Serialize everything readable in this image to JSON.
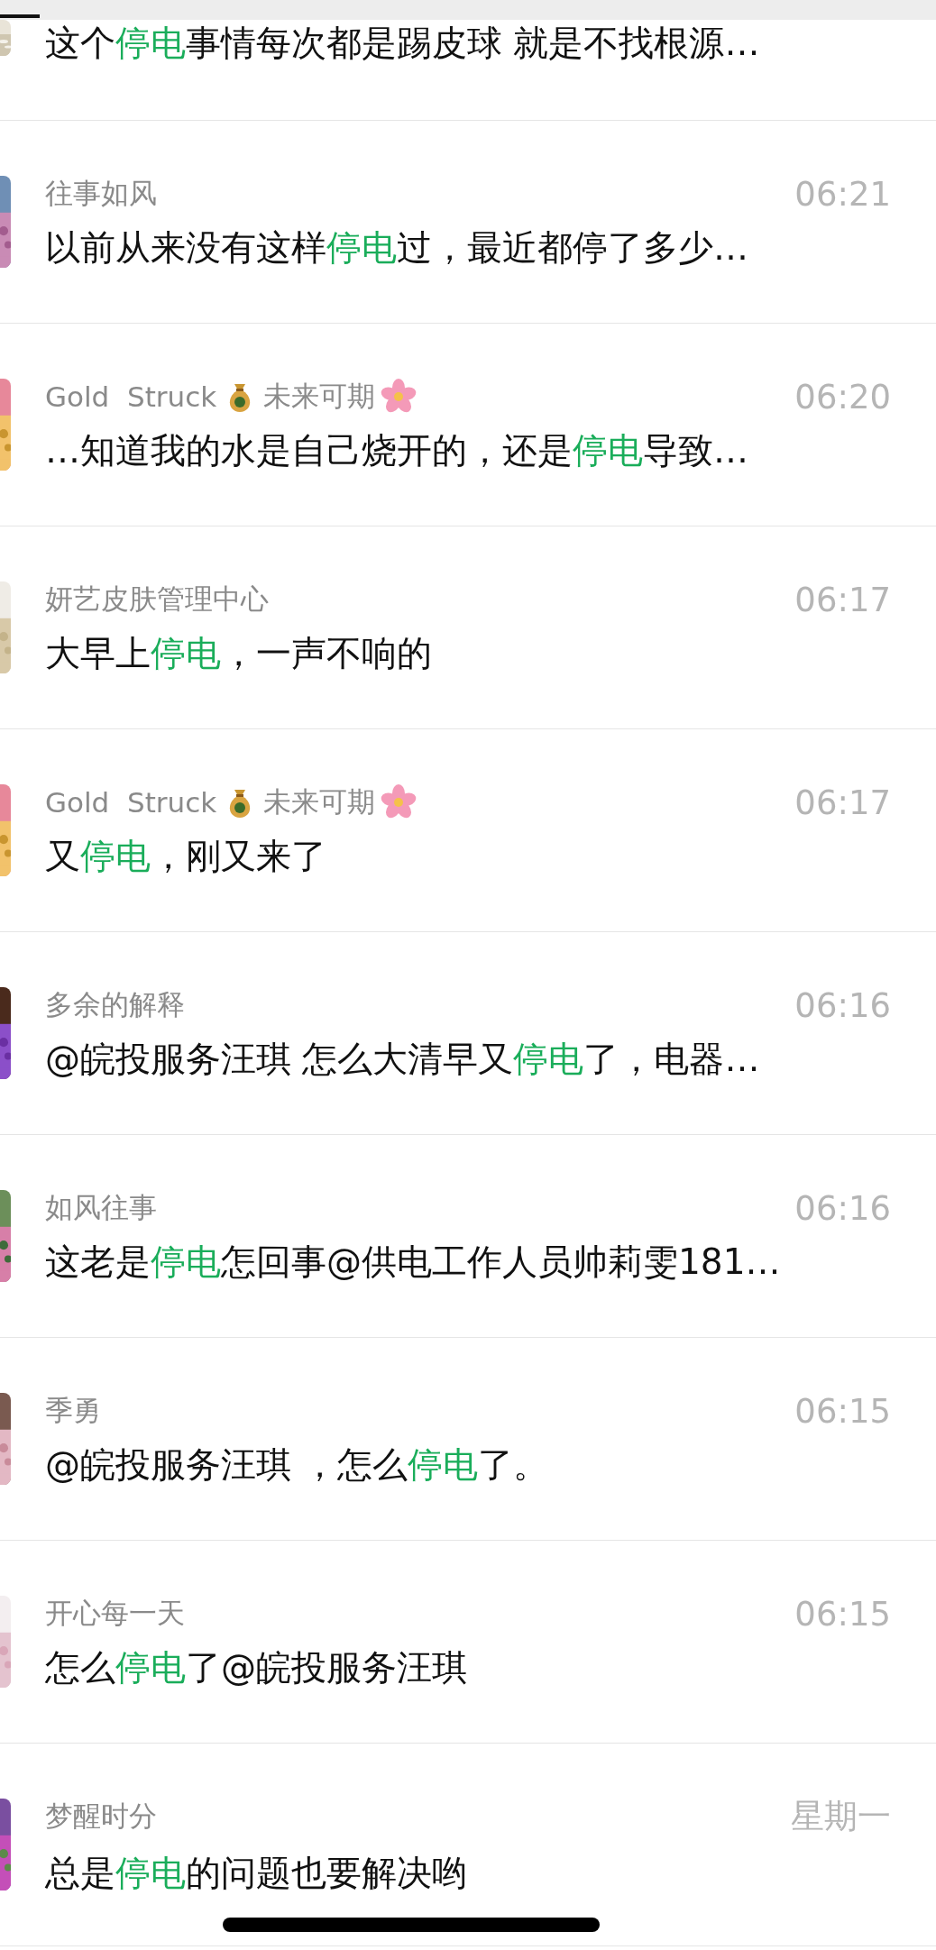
{
  "results": [
    {
      "partial": true,
      "message": [
        {
          "text": "这个",
          "highlight": false
        },
        {
          "text": "停电",
          "highlight": true
        },
        {
          "text": "事情每次都是踢皮球 就是不找根源…",
          "highlight": false
        }
      ]
    },
    {
      "name": [
        {
          "kind": "text",
          "text": "往事如风"
        }
      ],
      "time": "06:21",
      "message": [
        {
          "text": "以前从来没有这样",
          "highlight": false
        },
        {
          "text": "停电",
          "highlight": true
        },
        {
          "text": "过，最近都停了多少…",
          "highlight": false
        }
      ]
    },
    {
      "name": [
        {
          "kind": "text",
          "text": "Gold  Struck"
        },
        {
          "kind": "moneybag"
        },
        {
          "kind": "text",
          "text": "未来可期"
        },
        {
          "kind": "blossom"
        }
      ],
      "time": "06:20",
      "message": [
        {
          "text": "…知道我的水是自己烧开的，还是",
          "highlight": false
        },
        {
          "text": "停电",
          "highlight": true
        },
        {
          "text": "导致…",
          "highlight": false
        }
      ]
    },
    {
      "name": [
        {
          "kind": "text",
          "text": "妍艺皮肤管理中心"
        }
      ],
      "time": "06:17",
      "message": [
        {
          "text": "大早上",
          "highlight": false
        },
        {
          "text": "停电",
          "highlight": true
        },
        {
          "text": "，一声不响的",
          "highlight": false
        }
      ]
    },
    {
      "name": [
        {
          "kind": "text",
          "text": "Gold  Struck"
        },
        {
          "kind": "moneybag"
        },
        {
          "kind": "text",
          "text": "未来可期"
        },
        {
          "kind": "blossom"
        }
      ],
      "time": "06:17",
      "message": [
        {
          "text": "又",
          "highlight": false
        },
        {
          "text": "停电",
          "highlight": true
        },
        {
          "text": "，刚又来了",
          "highlight": false
        }
      ]
    },
    {
      "name": [
        {
          "kind": "text",
          "text": "多余的解释"
        }
      ],
      "time": "06:16",
      "message": [
        {
          "text": "@皖投服务汪琪 怎么大清早又",
          "highlight": false
        },
        {
          "text": "停电",
          "highlight": true
        },
        {
          "text": "了，电器…",
          "highlight": false
        }
      ]
    },
    {
      "name": [
        {
          "kind": "text",
          "text": "如风往事"
        }
      ],
      "time": "06:16",
      "message": [
        {
          "text": "这老是",
          "highlight": false
        },
        {
          "text": "停电",
          "highlight": true
        },
        {
          "text": "怎回事@供电工作人员帅莉雯181…",
          "highlight": false
        }
      ]
    },
    {
      "name": [
        {
          "kind": "text",
          "text": "季勇"
        }
      ],
      "time": "06:15",
      "message": [
        {
          "text": "@皖投服务汪琪 ，怎么",
          "highlight": false
        },
        {
          "text": "停电",
          "highlight": true
        },
        {
          "text": "了。",
          "highlight": false
        }
      ]
    },
    {
      "name": [
        {
          "kind": "text",
          "text": "开心每一天"
        }
      ],
      "time": "06:15",
      "message": [
        {
          "text": "怎么",
          "highlight": false
        },
        {
          "text": "停电",
          "highlight": true
        },
        {
          "text": "了@皖投服务汪琪",
          "highlight": false
        }
      ]
    },
    {
      "name": [
        {
          "kind": "text",
          "text": "梦醒时分"
        }
      ],
      "time": "星期一",
      "message": [
        {
          "text": "总是",
          "highlight": false
        },
        {
          "text": "停电",
          "highlight": true
        },
        {
          "text": "的问题也要解决哟",
          "highlight": false
        }
      ]
    }
  ]
}
